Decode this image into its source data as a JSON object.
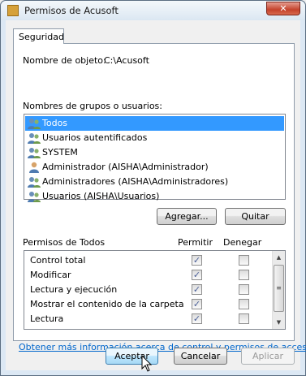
{
  "window": {
    "title": "Permisos de Acusoft",
    "close_glyph": "✕"
  },
  "tab": {
    "label": "Seguridad"
  },
  "object": {
    "label": "Nombre de objeto:",
    "value": "C:\\Acusoft"
  },
  "groups": {
    "label": "Nombres de grupos o usuarios:",
    "items": [
      {
        "label": "Todos",
        "icon": "users-group-icon",
        "selected": true
      },
      {
        "label": "Usuarios autentificados",
        "icon": "users-group-icon"
      },
      {
        "label": "SYSTEM",
        "icon": "users-group-icon"
      },
      {
        "label": "Administrador (AISHA\\Administrador)",
        "icon": "user-icon"
      },
      {
        "label": "Administradores (AISHA\\Administradores)",
        "icon": "users-group-icon"
      },
      {
        "label": "Usuarios (AISHA\\Usuarios)",
        "icon": "users-group-icon"
      }
    ]
  },
  "buttons": {
    "add": "Agregar...",
    "remove": "Quitar",
    "ok": "Aceptar",
    "cancel": "Cancelar",
    "apply": "Aplicar"
  },
  "permissions": {
    "label": "Permisos de Todos",
    "allow_header": "Permitir",
    "deny_header": "Denegar",
    "rows": [
      {
        "name": "Control total",
        "allow": true,
        "deny": false
      },
      {
        "name": "Modificar",
        "allow": true,
        "deny": false
      },
      {
        "name": "Lectura y ejecución",
        "allow": true,
        "deny": false
      },
      {
        "name": "Mostrar el contenido de la carpeta",
        "allow": true,
        "deny": false
      },
      {
        "name": "Lectura",
        "allow": true,
        "deny": false
      }
    ]
  },
  "link": {
    "text": "Obtener más información acerca de control y permisos de acceso"
  },
  "colors": {
    "selection": "#3399ff",
    "link": "#0066cc",
    "check": "#4a5f97"
  }
}
